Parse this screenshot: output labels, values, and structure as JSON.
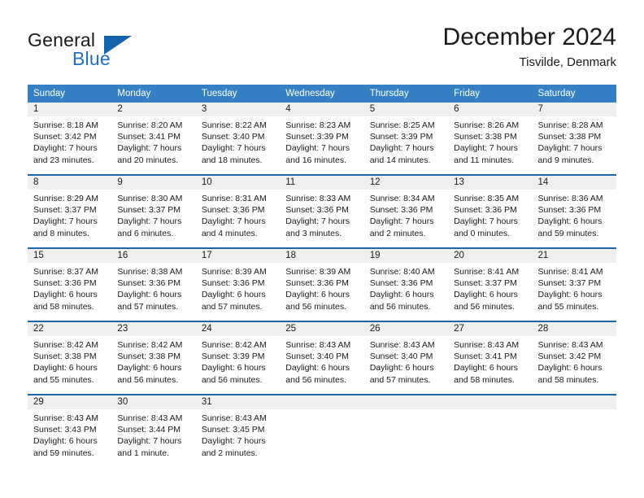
{
  "brand": {
    "name_part1": "General",
    "name_part2": "Blue",
    "triangle_color": "#1464ab",
    "blue_color": "#1f6fc4"
  },
  "header": {
    "title": "December 2024",
    "subtitle": "Tisvilde, Denmark"
  },
  "theme": {
    "header_bar_color": "#3580c4",
    "row_separator_color": "#1d64a8",
    "day_number_bg": "#efefef"
  },
  "weekdays": [
    "Sunday",
    "Monday",
    "Tuesday",
    "Wednesday",
    "Thursday",
    "Friday",
    "Saturday"
  ],
  "weeks": [
    [
      {
        "day": "1",
        "sunrise": "Sunrise: 8:18 AM",
        "sunset": "Sunset: 3:42 PM",
        "daylight1": "Daylight: 7 hours",
        "daylight2": "and 23 minutes."
      },
      {
        "day": "2",
        "sunrise": "Sunrise: 8:20 AM",
        "sunset": "Sunset: 3:41 PM",
        "daylight1": "Daylight: 7 hours",
        "daylight2": "and 20 minutes."
      },
      {
        "day": "3",
        "sunrise": "Sunrise: 8:22 AM",
        "sunset": "Sunset: 3:40 PM",
        "daylight1": "Daylight: 7 hours",
        "daylight2": "and 18 minutes."
      },
      {
        "day": "4",
        "sunrise": "Sunrise: 8:23 AM",
        "sunset": "Sunset: 3:39 PM",
        "daylight1": "Daylight: 7 hours",
        "daylight2": "and 16 minutes."
      },
      {
        "day": "5",
        "sunrise": "Sunrise: 8:25 AM",
        "sunset": "Sunset: 3:39 PM",
        "daylight1": "Daylight: 7 hours",
        "daylight2": "and 14 minutes."
      },
      {
        "day": "6",
        "sunrise": "Sunrise: 8:26 AM",
        "sunset": "Sunset: 3:38 PM",
        "daylight1": "Daylight: 7 hours",
        "daylight2": "and 11 minutes."
      },
      {
        "day": "7",
        "sunrise": "Sunrise: 8:28 AM",
        "sunset": "Sunset: 3:38 PM",
        "daylight1": "Daylight: 7 hours",
        "daylight2": "and 9 minutes."
      }
    ],
    [
      {
        "day": "8",
        "sunrise": "Sunrise: 8:29 AM",
        "sunset": "Sunset: 3:37 PM",
        "daylight1": "Daylight: 7 hours",
        "daylight2": "and 8 minutes."
      },
      {
        "day": "9",
        "sunrise": "Sunrise: 8:30 AM",
        "sunset": "Sunset: 3:37 PM",
        "daylight1": "Daylight: 7 hours",
        "daylight2": "and 6 minutes."
      },
      {
        "day": "10",
        "sunrise": "Sunrise: 8:31 AM",
        "sunset": "Sunset: 3:36 PM",
        "daylight1": "Daylight: 7 hours",
        "daylight2": "and 4 minutes."
      },
      {
        "day": "11",
        "sunrise": "Sunrise: 8:33 AM",
        "sunset": "Sunset: 3:36 PM",
        "daylight1": "Daylight: 7 hours",
        "daylight2": "and 3 minutes."
      },
      {
        "day": "12",
        "sunrise": "Sunrise: 8:34 AM",
        "sunset": "Sunset: 3:36 PM",
        "daylight1": "Daylight: 7 hours",
        "daylight2": "and 2 minutes."
      },
      {
        "day": "13",
        "sunrise": "Sunrise: 8:35 AM",
        "sunset": "Sunset: 3:36 PM",
        "daylight1": "Daylight: 7 hours",
        "daylight2": "and 0 minutes."
      },
      {
        "day": "14",
        "sunrise": "Sunrise: 8:36 AM",
        "sunset": "Sunset: 3:36 PM",
        "daylight1": "Daylight: 6 hours",
        "daylight2": "and 59 minutes."
      }
    ],
    [
      {
        "day": "15",
        "sunrise": "Sunrise: 8:37 AM",
        "sunset": "Sunset: 3:36 PM",
        "daylight1": "Daylight: 6 hours",
        "daylight2": "and 58 minutes."
      },
      {
        "day": "16",
        "sunrise": "Sunrise: 8:38 AM",
        "sunset": "Sunset: 3:36 PM",
        "daylight1": "Daylight: 6 hours",
        "daylight2": "and 57 minutes."
      },
      {
        "day": "17",
        "sunrise": "Sunrise: 8:39 AM",
        "sunset": "Sunset: 3:36 PM",
        "daylight1": "Daylight: 6 hours",
        "daylight2": "and 57 minutes."
      },
      {
        "day": "18",
        "sunrise": "Sunrise: 8:39 AM",
        "sunset": "Sunset: 3:36 PM",
        "daylight1": "Daylight: 6 hours",
        "daylight2": "and 56 minutes."
      },
      {
        "day": "19",
        "sunrise": "Sunrise: 8:40 AM",
        "sunset": "Sunset: 3:36 PM",
        "daylight1": "Daylight: 6 hours",
        "daylight2": "and 56 minutes."
      },
      {
        "day": "20",
        "sunrise": "Sunrise: 8:41 AM",
        "sunset": "Sunset: 3:37 PM",
        "daylight1": "Daylight: 6 hours",
        "daylight2": "and 56 minutes."
      },
      {
        "day": "21",
        "sunrise": "Sunrise: 8:41 AM",
        "sunset": "Sunset: 3:37 PM",
        "daylight1": "Daylight: 6 hours",
        "daylight2": "and 55 minutes."
      }
    ],
    [
      {
        "day": "22",
        "sunrise": "Sunrise: 8:42 AM",
        "sunset": "Sunset: 3:38 PM",
        "daylight1": "Daylight: 6 hours",
        "daylight2": "and 55 minutes."
      },
      {
        "day": "23",
        "sunrise": "Sunrise: 8:42 AM",
        "sunset": "Sunset: 3:38 PM",
        "daylight1": "Daylight: 6 hours",
        "daylight2": "and 56 minutes."
      },
      {
        "day": "24",
        "sunrise": "Sunrise: 8:42 AM",
        "sunset": "Sunset: 3:39 PM",
        "daylight1": "Daylight: 6 hours",
        "daylight2": "and 56 minutes."
      },
      {
        "day": "25",
        "sunrise": "Sunrise: 8:43 AM",
        "sunset": "Sunset: 3:40 PM",
        "daylight1": "Daylight: 6 hours",
        "daylight2": "and 56 minutes."
      },
      {
        "day": "26",
        "sunrise": "Sunrise: 8:43 AM",
        "sunset": "Sunset: 3:40 PM",
        "daylight1": "Daylight: 6 hours",
        "daylight2": "and 57 minutes."
      },
      {
        "day": "27",
        "sunrise": "Sunrise: 8:43 AM",
        "sunset": "Sunset: 3:41 PM",
        "daylight1": "Daylight: 6 hours",
        "daylight2": "and 58 minutes."
      },
      {
        "day": "28",
        "sunrise": "Sunrise: 8:43 AM",
        "sunset": "Sunset: 3:42 PM",
        "daylight1": "Daylight: 6 hours",
        "daylight2": "and 58 minutes."
      }
    ],
    [
      {
        "day": "29",
        "sunrise": "Sunrise: 8:43 AM",
        "sunset": "Sunset: 3:43 PM",
        "daylight1": "Daylight: 6 hours",
        "daylight2": "and 59 minutes."
      },
      {
        "day": "30",
        "sunrise": "Sunrise: 8:43 AM",
        "sunset": "Sunset: 3:44 PM",
        "daylight1": "Daylight: 7 hours",
        "daylight2": "and 1 minute."
      },
      {
        "day": "31",
        "sunrise": "Sunrise: 8:43 AM",
        "sunset": "Sunset: 3:45 PM",
        "daylight1": "Daylight: 7 hours",
        "daylight2": "and 2 minutes."
      },
      {
        "day": "",
        "sunrise": "",
        "sunset": "",
        "daylight1": "",
        "daylight2": ""
      },
      {
        "day": "",
        "sunrise": "",
        "sunset": "",
        "daylight1": "",
        "daylight2": ""
      },
      {
        "day": "",
        "sunrise": "",
        "sunset": "",
        "daylight1": "",
        "daylight2": ""
      },
      {
        "day": "",
        "sunrise": "",
        "sunset": "",
        "daylight1": "",
        "daylight2": ""
      }
    ]
  ]
}
